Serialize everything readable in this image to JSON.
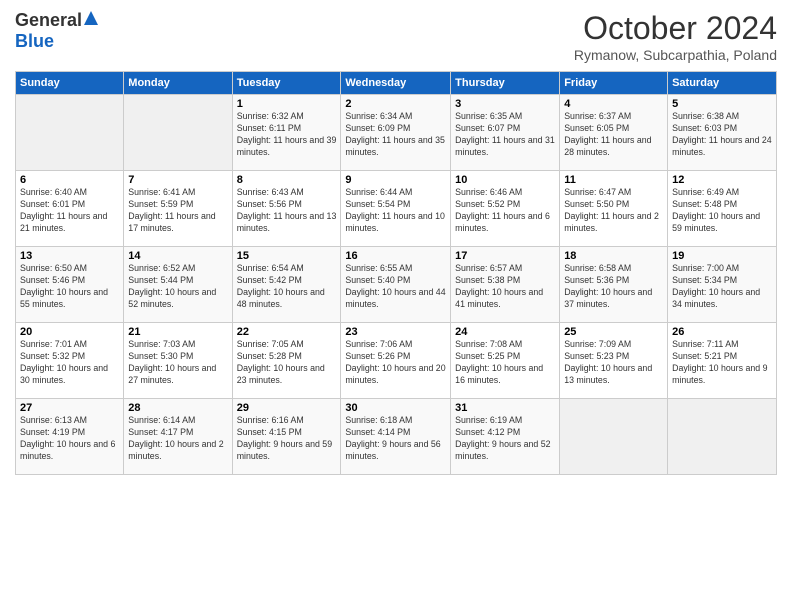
{
  "header": {
    "logo_general": "General",
    "logo_blue": "Blue",
    "month_title": "October 2024",
    "location": "Rymanow, Subcarpathia, Poland"
  },
  "weekdays": [
    "Sunday",
    "Monday",
    "Tuesday",
    "Wednesday",
    "Thursday",
    "Friday",
    "Saturday"
  ],
  "weeks": [
    [
      {
        "day": "",
        "empty": true
      },
      {
        "day": "",
        "empty": true
      },
      {
        "day": "1",
        "sunrise": "Sunrise: 6:32 AM",
        "sunset": "Sunset: 6:11 PM",
        "daylight": "Daylight: 11 hours and 39 minutes."
      },
      {
        "day": "2",
        "sunrise": "Sunrise: 6:34 AM",
        "sunset": "Sunset: 6:09 PM",
        "daylight": "Daylight: 11 hours and 35 minutes."
      },
      {
        "day": "3",
        "sunrise": "Sunrise: 6:35 AM",
        "sunset": "Sunset: 6:07 PM",
        "daylight": "Daylight: 11 hours and 31 minutes."
      },
      {
        "day": "4",
        "sunrise": "Sunrise: 6:37 AM",
        "sunset": "Sunset: 6:05 PM",
        "daylight": "Daylight: 11 hours and 28 minutes."
      },
      {
        "day": "5",
        "sunrise": "Sunrise: 6:38 AM",
        "sunset": "Sunset: 6:03 PM",
        "daylight": "Daylight: 11 hours and 24 minutes."
      }
    ],
    [
      {
        "day": "6",
        "sunrise": "Sunrise: 6:40 AM",
        "sunset": "Sunset: 6:01 PM",
        "daylight": "Daylight: 11 hours and 21 minutes."
      },
      {
        "day": "7",
        "sunrise": "Sunrise: 6:41 AM",
        "sunset": "Sunset: 5:59 PM",
        "daylight": "Daylight: 11 hours and 17 minutes."
      },
      {
        "day": "8",
        "sunrise": "Sunrise: 6:43 AM",
        "sunset": "Sunset: 5:56 PM",
        "daylight": "Daylight: 11 hours and 13 minutes."
      },
      {
        "day": "9",
        "sunrise": "Sunrise: 6:44 AM",
        "sunset": "Sunset: 5:54 PM",
        "daylight": "Daylight: 11 hours and 10 minutes."
      },
      {
        "day": "10",
        "sunrise": "Sunrise: 6:46 AM",
        "sunset": "Sunset: 5:52 PM",
        "daylight": "Daylight: 11 hours and 6 minutes."
      },
      {
        "day": "11",
        "sunrise": "Sunrise: 6:47 AM",
        "sunset": "Sunset: 5:50 PM",
        "daylight": "Daylight: 11 hours and 2 minutes."
      },
      {
        "day": "12",
        "sunrise": "Sunrise: 6:49 AM",
        "sunset": "Sunset: 5:48 PM",
        "daylight": "Daylight: 10 hours and 59 minutes."
      }
    ],
    [
      {
        "day": "13",
        "sunrise": "Sunrise: 6:50 AM",
        "sunset": "Sunset: 5:46 PM",
        "daylight": "Daylight: 10 hours and 55 minutes."
      },
      {
        "day": "14",
        "sunrise": "Sunrise: 6:52 AM",
        "sunset": "Sunset: 5:44 PM",
        "daylight": "Daylight: 10 hours and 52 minutes."
      },
      {
        "day": "15",
        "sunrise": "Sunrise: 6:54 AM",
        "sunset": "Sunset: 5:42 PM",
        "daylight": "Daylight: 10 hours and 48 minutes."
      },
      {
        "day": "16",
        "sunrise": "Sunrise: 6:55 AM",
        "sunset": "Sunset: 5:40 PM",
        "daylight": "Daylight: 10 hours and 44 minutes."
      },
      {
        "day": "17",
        "sunrise": "Sunrise: 6:57 AM",
        "sunset": "Sunset: 5:38 PM",
        "daylight": "Daylight: 10 hours and 41 minutes."
      },
      {
        "day": "18",
        "sunrise": "Sunrise: 6:58 AM",
        "sunset": "Sunset: 5:36 PM",
        "daylight": "Daylight: 10 hours and 37 minutes."
      },
      {
        "day": "19",
        "sunrise": "Sunrise: 7:00 AM",
        "sunset": "Sunset: 5:34 PM",
        "daylight": "Daylight: 10 hours and 34 minutes."
      }
    ],
    [
      {
        "day": "20",
        "sunrise": "Sunrise: 7:01 AM",
        "sunset": "Sunset: 5:32 PM",
        "daylight": "Daylight: 10 hours and 30 minutes."
      },
      {
        "day": "21",
        "sunrise": "Sunrise: 7:03 AM",
        "sunset": "Sunset: 5:30 PM",
        "daylight": "Daylight: 10 hours and 27 minutes."
      },
      {
        "day": "22",
        "sunrise": "Sunrise: 7:05 AM",
        "sunset": "Sunset: 5:28 PM",
        "daylight": "Daylight: 10 hours and 23 minutes."
      },
      {
        "day": "23",
        "sunrise": "Sunrise: 7:06 AM",
        "sunset": "Sunset: 5:26 PM",
        "daylight": "Daylight: 10 hours and 20 minutes."
      },
      {
        "day": "24",
        "sunrise": "Sunrise: 7:08 AM",
        "sunset": "Sunset: 5:25 PM",
        "daylight": "Daylight: 10 hours and 16 minutes."
      },
      {
        "day": "25",
        "sunrise": "Sunrise: 7:09 AM",
        "sunset": "Sunset: 5:23 PM",
        "daylight": "Daylight: 10 hours and 13 minutes."
      },
      {
        "day": "26",
        "sunrise": "Sunrise: 7:11 AM",
        "sunset": "Sunset: 5:21 PM",
        "daylight": "Daylight: 10 hours and 9 minutes."
      }
    ],
    [
      {
        "day": "27",
        "sunrise": "Sunrise: 6:13 AM",
        "sunset": "Sunset: 4:19 PM",
        "daylight": "Daylight: 10 hours and 6 minutes."
      },
      {
        "day": "28",
        "sunrise": "Sunrise: 6:14 AM",
        "sunset": "Sunset: 4:17 PM",
        "daylight": "Daylight: 10 hours and 2 minutes."
      },
      {
        "day": "29",
        "sunrise": "Sunrise: 6:16 AM",
        "sunset": "Sunset: 4:15 PM",
        "daylight": "Daylight: 9 hours and 59 minutes."
      },
      {
        "day": "30",
        "sunrise": "Sunrise: 6:18 AM",
        "sunset": "Sunset: 4:14 PM",
        "daylight": "Daylight: 9 hours and 56 minutes."
      },
      {
        "day": "31",
        "sunrise": "Sunrise: 6:19 AM",
        "sunset": "Sunset: 4:12 PM",
        "daylight": "Daylight: 9 hours and 52 minutes."
      },
      {
        "day": "",
        "empty": true
      },
      {
        "day": "",
        "empty": true
      }
    ]
  ]
}
